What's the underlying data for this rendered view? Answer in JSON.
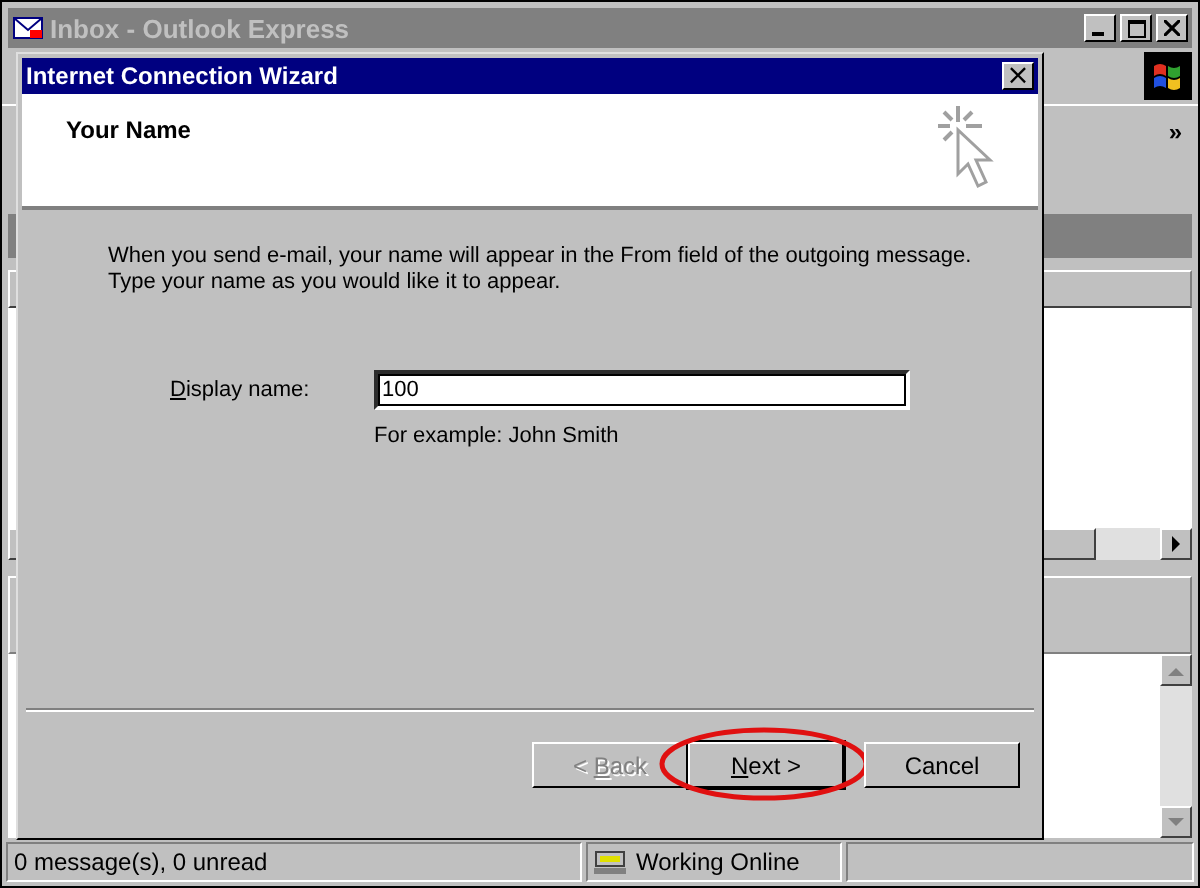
{
  "main_window": {
    "title": "Inbox - Outlook Express",
    "active": false,
    "toolbar_chevron": "»"
  },
  "status_bar": {
    "message_count": "0 message(s), 0 unread",
    "connection": "Working Online"
  },
  "dialog": {
    "title": "Internet Connection Wizard",
    "close": "×",
    "header": {
      "title": "Your Name"
    },
    "description": [
      "When you send e-mail, your name will appear in the From field of the outgoing message.",
      "Type your name as you would like it to appear."
    ],
    "field": {
      "access_key": "D",
      "label_rest": "isplay name:",
      "value": "100",
      "hint": "For example: John Smith"
    },
    "buttons": [
      {
        "kind": "back",
        "access_key": "B",
        "label_rest": "ack",
        "prefix": "< ",
        "disabled": true,
        "default": false,
        "circled": false
      },
      {
        "kind": "next",
        "access_key": "N",
        "label_rest": "ext >",
        "disabled": false,
        "default": true,
        "circled": true
      },
      {
        "kind": "cancel",
        "label_rest": "Cancel",
        "disabled": false,
        "default": false,
        "circled": false
      }
    ]
  }
}
